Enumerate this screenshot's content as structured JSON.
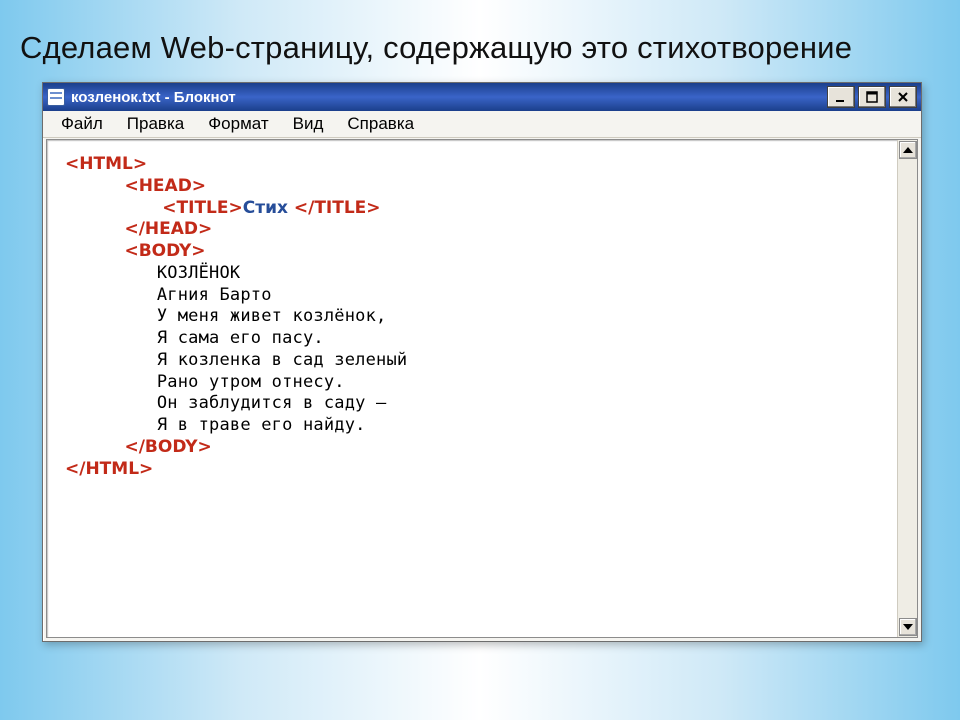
{
  "heading": "Сделаем Web-страницу, содержащую это стихотворение",
  "window": {
    "title": "козленок.txt - Блокнот",
    "menu": [
      "Файл",
      "Правка",
      "Формат",
      "Вид",
      "Справка"
    ]
  },
  "code": {
    "l1_html_open": "<HTML>",
    "l2_head_open": "<HEAD>",
    "l3_title_open": "<TITLE>",
    "l3_title_text": "Стих ",
    "l3_title_close": "</TITLE>",
    "l4_head_close": "</HEAD>",
    "l5_body_open": "<BODY>",
    "poem": [
      "КОЗЛЁНОК",
      "Агния Барто",
      "У меня живет козлёнок,",
      "Я сама его пасу.",
      "Я козленка в сад зеленый",
      "Рано утром отнесу.",
      "Он заблудится в саду –",
      "Я в траве его найду."
    ],
    "l_body_close": "</BODY>",
    "l_html_close": "</HTML>"
  }
}
